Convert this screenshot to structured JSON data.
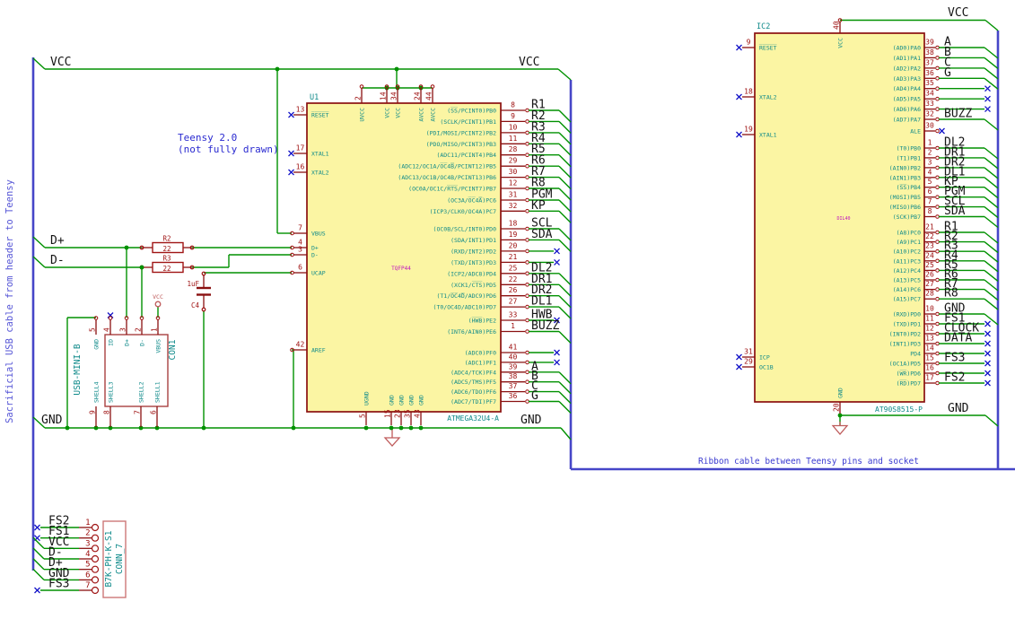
{
  "sheet": {
    "margin_note": "Sacrificial USB cable from header to Teensy",
    "teensy_note_1": "Teensy 2.0",
    "teensy_note_2": "(not fully drawn)",
    "ribbon_note": "Ribbon cable between Teensy pins and socket"
  },
  "nets": {
    "vcc": "VCC",
    "gnd": "GND",
    "dplus": "D+",
    "dminus": "D-"
  },
  "colors": {
    "wire": "#009100",
    "bus": "#4646C8",
    "body_outline": "#8A1010",
    "body_fill": "#FBF5A3",
    "pin_name": "#0F8A8A",
    "pin_number": "#9C0B0B",
    "net_label": "#141414",
    "note": "#2A2AD0",
    "no_connect": "#1414C8"
  },
  "u1": {
    "ref": "U1",
    "value": "TQFP44",
    "part": "ATMEGA32U4-A",
    "top_pins": {
      "nums": [
        "2",
        "14",
        "34",
        "24",
        "44"
      ],
      "names": [
        "UVCC",
        "VCC",
        "VCC",
        "AVCC",
        "AVCC"
      ]
    },
    "bottom_pins": {
      "nums": [
        "5",
        "15",
        "23",
        "35",
        "43"
      ],
      "names": [
        "UGND",
        "GND",
        "GND",
        "GND",
        "GND"
      ]
    },
    "left_pins": [
      {
        "num": "13",
        "name": "R̅E̅S̅E̅T̅",
        "conn": "nc"
      },
      {
        "num": "17",
        "name": "XTAL1",
        "conn": "nc"
      },
      {
        "num": "16",
        "name": "XTAL2",
        "conn": "nc"
      },
      {
        "num": "7",
        "name": "VBUS",
        "conn": "wire"
      },
      {
        "num": "4",
        "name": "D+",
        "conn": "wire"
      },
      {
        "num": "3",
        "name": "D-",
        "conn": "wire"
      },
      {
        "num": "6",
        "name": "UCAP",
        "conn": "wire"
      },
      {
        "num": "42",
        "name": "AREF",
        "conn": "wire"
      }
    ],
    "right_groups": [
      [
        {
          "num": "8",
          "name": "(S̅S̅/PCINT0)PB0",
          "net": "R1",
          "conn": "bus"
        },
        {
          "num": "9",
          "name": "(SCLK/PCINT1)PB1",
          "net": "R2",
          "conn": "bus"
        },
        {
          "num": "10",
          "name": "(PDI/MOSI/PCINT2)PB2",
          "net": "R3",
          "conn": "bus"
        },
        {
          "num": "11",
          "name": "(PDO/MISO/PCINT3)PB3",
          "net": "R4",
          "conn": "bus"
        },
        {
          "num": "28",
          "name": "(ADC11/PCINT4)PB4",
          "net": "R5",
          "conn": "bus"
        },
        {
          "num": "29",
          "name": "(ADC12/OC1A/O̅C̅4̅B̅/PCINT12)PB5",
          "net": "R6",
          "conn": "bus"
        },
        {
          "num": "30",
          "name": "(ADC13/OC1B/OC4B/PCINT13)PB6",
          "net": "R7",
          "conn": "bus"
        },
        {
          "num": "12",
          "name": "(OC0A/OC1C/R̅T̅S̅/PCINT7)PB7",
          "net": "R8",
          "conn": "bus"
        }
      ],
      [
        {
          "num": "31",
          "name": "(OC3A/O̅C̅4̅A̅)PC6",
          "net": "PGM",
          "conn": "bus"
        },
        {
          "num": "32",
          "name": "(ICP3/CLK0/OC4A)PC7",
          "net": "KP",
          "conn": "bus"
        }
      ],
      [
        {
          "num": "18",
          "name": "(OC0B/SCL/INT0)PD0",
          "net": "SCL",
          "conn": "bus"
        },
        {
          "num": "19",
          "name": "(SDA/INT1)PD1",
          "net": "SDA",
          "conn": "bus"
        },
        {
          "num": "20",
          "name": "(RXD/INT2)PD2",
          "net": "",
          "conn": "nc"
        },
        {
          "num": "21",
          "name": "(TXD/INT3)PD3",
          "net": "",
          "conn": "nc"
        },
        {
          "num": "25",
          "name": "(ICP2/ADC8)PD4",
          "net": "DL2",
          "conn": "bus"
        },
        {
          "num": "22",
          "name": "(XCK1/C̅T̅S̅)PD5",
          "net": "DR1",
          "conn": "bus"
        },
        {
          "num": "26",
          "name": "(T1/O̅C̅4̅D̅/ADC9)PD6",
          "net": "DR2",
          "conn": "bus"
        },
        {
          "num": "27",
          "name": "(T0/OC4D/ADC10)PD7",
          "net": "DL1",
          "conn": "bus"
        }
      ],
      [
        {
          "num": "33",
          "name": "(H̅W̅B̅)PE2",
          "net": "HWB",
          "conn": "ncl"
        },
        {
          "num": "1",
          "name": "(INT6/AIN0)PE6",
          "net": "BUZZ",
          "conn": "bus"
        }
      ],
      [
        {
          "num": "41",
          "name": "(ADC0)PF0",
          "net": "",
          "conn": "nc"
        },
        {
          "num": "40",
          "name": "(ADC1)PF1",
          "net": "",
          "conn": "nc"
        },
        {
          "num": "39",
          "name": "(ADC4/TCK)PF4",
          "net": "A",
          "conn": "bus"
        },
        {
          "num": "38",
          "name": "(ADC5/TMS)PF5",
          "net": "B",
          "conn": "bus"
        },
        {
          "num": "37",
          "name": "(ADC6/TDO)PF6",
          "net": "C",
          "conn": "bus"
        },
        {
          "num": "36",
          "name": "(ADC7/TDI)PF7",
          "net": "G",
          "conn": "bus"
        }
      ]
    ]
  },
  "ic2": {
    "ref": "IC2",
    "value": "DIL40",
    "part": "AT90S8515-P",
    "top_pin": {
      "nums": [
        "40"
      ],
      "names": [
        "VCC"
      ]
    },
    "bottom_pin": {
      "nums": [
        "20"
      ],
      "names": [
        "GND"
      ]
    },
    "left_pins": [
      {
        "num": "9",
        "name": "R̅E̅S̅E̅T̅",
        "conn": "nc"
      },
      {
        "num": "18",
        "name": "XTAL2",
        "conn": "nc"
      },
      {
        "num": "19",
        "name": "XTAL1",
        "conn": "nc"
      },
      {
        "num": "31",
        "name": "ICP",
        "conn": "nc"
      },
      {
        "num": "29",
        "name": "OC1B",
        "conn": "nc"
      }
    ],
    "right_groups": [
      [
        {
          "num": "39",
          "name": "(AD0)PA0",
          "net": "A",
          "conn": "bus"
        },
        {
          "num": "38",
          "name": "(AD1)PA1",
          "net": "B",
          "conn": "bus"
        },
        {
          "num": "37",
          "name": "(AD2)PA2",
          "net": "C",
          "conn": "bus"
        },
        {
          "num": "36",
          "name": "(AD3)PA3",
          "net": "G",
          "conn": "bus"
        },
        {
          "num": "35",
          "name": "(AD4)PA4",
          "net": "",
          "conn": "nc"
        },
        {
          "num": "34",
          "name": "(AD5)PA5",
          "net": "",
          "conn": "nc"
        },
        {
          "num": "33",
          "name": "(AD6)PA6",
          "net": "",
          "conn": "nc"
        },
        {
          "num": "32",
          "name": "(AD7)PA7",
          "net": "BUZZ",
          "conn": "bus"
        }
      ],
      [
        {
          "num": "30",
          "name": "ALE",
          "net": "",
          "conn": "ncs"
        }
      ],
      [
        {
          "num": "1",
          "name": "(T0)PB0",
          "net": "DL2",
          "conn": "bus"
        },
        {
          "num": "2",
          "name": "(T1)PB1",
          "net": "DR1",
          "conn": "bus"
        },
        {
          "num": "3",
          "name": "(AIN0)PB2",
          "net": "DR2",
          "conn": "bus"
        },
        {
          "num": "4",
          "name": "(AIN1)PB3",
          "net": "DL1",
          "conn": "bus"
        },
        {
          "num": "5",
          "name": "(S̅S̅)PB4",
          "net": "KP",
          "conn": "bus"
        },
        {
          "num": "6",
          "name": "(MOSI)PB5",
          "net": "PGM",
          "conn": "bus"
        },
        {
          "num": "7",
          "name": "(MISO)PB6",
          "net": "SCL",
          "conn": "bus"
        },
        {
          "num": "8",
          "name": "(SCK)PB7",
          "net": "SDA",
          "conn": "bus"
        }
      ],
      [
        {
          "num": "21",
          "name": "(A8)PC0",
          "net": "R1",
          "conn": "bus"
        },
        {
          "num": "22",
          "name": "(A9)PC1",
          "net": "R2",
          "conn": "bus"
        },
        {
          "num": "23",
          "name": "(A10)PC2",
          "net": "R3",
          "conn": "bus"
        },
        {
          "num": "24",
          "name": "(A11)PC3",
          "net": "R4",
          "conn": "bus"
        },
        {
          "num": "25",
          "name": "(A12)PC4",
          "net": "R5",
          "conn": "bus"
        },
        {
          "num": "26",
          "name": "(A13)PC5",
          "net": "R6",
          "conn": "bus"
        },
        {
          "num": "27",
          "name": "(A14)PC6",
          "net": "R7",
          "conn": "bus"
        },
        {
          "num": "28",
          "name": "(A15)PC7",
          "net": "R8",
          "conn": "bus"
        }
      ],
      [
        {
          "num": "10",
          "name": "(RXD)PD0",
          "net": "GND",
          "conn": "bus"
        },
        {
          "num": "11",
          "name": "(TXD)PD1",
          "net": "FS1",
          "conn": "ncl"
        },
        {
          "num": "12",
          "name": "(INT0)PD2",
          "net": "CLOCK",
          "conn": "ncl"
        },
        {
          "num": "13",
          "name": "(INT1)PD3",
          "net": "DATA",
          "conn": "ncl"
        },
        {
          "num": "14",
          "name": "PD4",
          "net": "",
          "conn": "nc"
        },
        {
          "num": "15",
          "name": "(OC1A)PD5",
          "net": "FS3",
          "conn": "ncl"
        },
        {
          "num": "16",
          "name": "(W̅R̅)PD6",
          "net": "",
          "conn": "nc"
        },
        {
          "num": "17",
          "name": "(R̅D̅)PD7",
          "net": "FS2",
          "conn": "ncl"
        }
      ]
    ]
  },
  "usb": {
    "name": "USB-MINI-B",
    "ref": "CON1",
    "top_pins": {
      "nums": [
        "5",
        "4",
        "3",
        "2",
        "1"
      ],
      "names": [
        "GND",
        "ID",
        "D+",
        "D-",
        "VBUS"
      ]
    },
    "bottom_pins": {
      "nums": [
        "9",
        "8",
        "7",
        "6"
      ],
      "names": [
        "SHELL4",
        "SHELL3",
        "SHELL2",
        "SHELL1"
      ]
    }
  },
  "conn7": {
    "ref": "CONN_7",
    "value": "B7K-PH-K-S1",
    "pins": [
      {
        "num": "1",
        "net": "FS2",
        "conn": "nc"
      },
      {
        "num": "2",
        "net": "FS1",
        "conn": "nc"
      },
      {
        "num": "3",
        "net": "VCC",
        "conn": "bus"
      },
      {
        "num": "4",
        "net": "D-",
        "conn": "bus"
      },
      {
        "num": "5",
        "net": "D+",
        "conn": "bus"
      },
      {
        "num": "6",
        "net": "GND",
        "conn": "bus"
      },
      {
        "num": "7",
        "net": "FS3",
        "conn": "nc"
      }
    ]
  },
  "r2": {
    "ref": "R2",
    "value": "22"
  },
  "r3": {
    "ref": "R3",
    "value": "22"
  },
  "c4": {
    "ref": "C4",
    "value": "1uF"
  },
  "power": {
    "vcc": "VCC"
  }
}
